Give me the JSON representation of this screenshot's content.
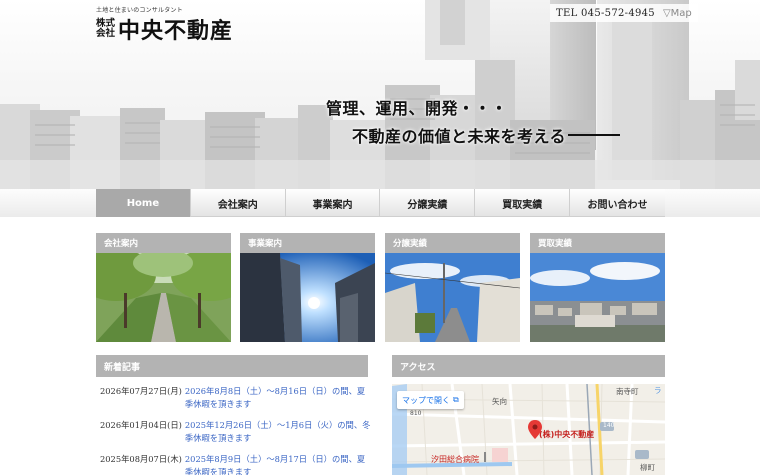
{
  "header": {
    "tagline": "土地と住まいのコンサルタント",
    "logo_kabu_1": "株式",
    "logo_kabu_2": "会社",
    "logo_name": "中央不動産",
    "tel": "TEL 045-572-4945",
    "map_link": "▽Map"
  },
  "hero": {
    "catch_line1": "管理、運用、開発・・・",
    "catch_line2": "不動産の価値と未来を考える"
  },
  "nav": {
    "items": [
      {
        "label": "Home",
        "active": true
      },
      {
        "label": "会社案内"
      },
      {
        "label": "事業案内"
      },
      {
        "label": "分譲実績"
      },
      {
        "label": "買取実績"
      },
      {
        "label": "お問い合わせ"
      }
    ]
  },
  "cards": [
    {
      "label": "会社案内"
    },
    {
      "label": "事業案内"
    },
    {
      "label": "分譲実績"
    },
    {
      "label": "買取実績"
    }
  ],
  "news": {
    "heading": "新着記事",
    "items": [
      {
        "date": "2026年07月27日(月)",
        "text": "2026年8月8日（土）～8月16日（日）の間、夏季休暇を頂きます"
      },
      {
        "date": "2026年01月04日(日)",
        "text": "2025年12月26日（土）～1月6日（火）の間、冬季休暇を頂きます"
      },
      {
        "date": "2025年08月07日(木)",
        "text": "2025年8月9日（土）～8月17日（日）の間、夏季休暇を頂きます"
      }
    ]
  },
  "access": {
    "heading": "アクセス",
    "map_open": "マップで開く",
    "place_label": "(株)中央不動産",
    "hospital_label": "汐田総合病院",
    "labels": {
      "minamiteramachi": "南寺町",
      "yamuko": "矢向",
      "yanagi": "柳町",
      "route": "140",
      "ra": "ラ",
      "n810": "810"
    }
  },
  "colors": {
    "nav_active": "#a9a9a9",
    "section_head": "#b3b3b3",
    "link": "#3b66c4",
    "map_pin": "#e53935"
  }
}
